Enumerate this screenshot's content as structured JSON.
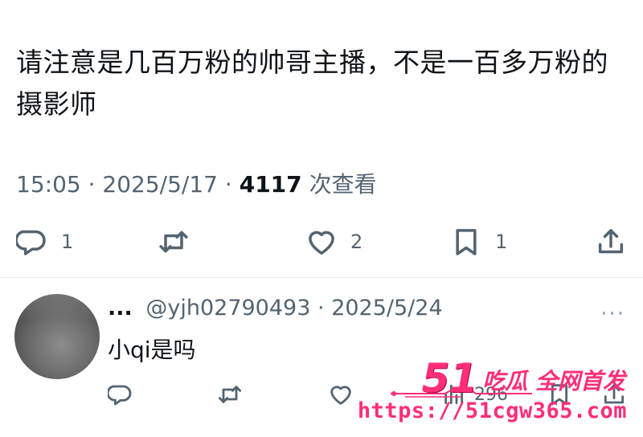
{
  "tweet": {
    "text": "请注意是几百万粉的帅哥主播，不是一百多万粉的摄影师",
    "time": "15:05",
    "date": "2025/5/17",
    "views_count": "4117",
    "views_label": "次查看",
    "separator": "·"
  },
  "actions": {
    "reply_count": "1",
    "retweet_count": "",
    "like_count": "2",
    "bookmark_count": "1"
  },
  "reply": {
    "name": "...",
    "handle": "@yjh02790493",
    "date": "2025/5/24",
    "separator": "·",
    "more": "···",
    "text": "小qi是吗",
    "views_count": "296"
  },
  "watermark": {
    "number": "51",
    "slogan": "吃瓜 全网首发",
    "url": "https://51cgw365.com"
  },
  "colors": {
    "text": "#0f1419",
    "secondary": "#536471",
    "watermark": "#ff2d7a"
  }
}
